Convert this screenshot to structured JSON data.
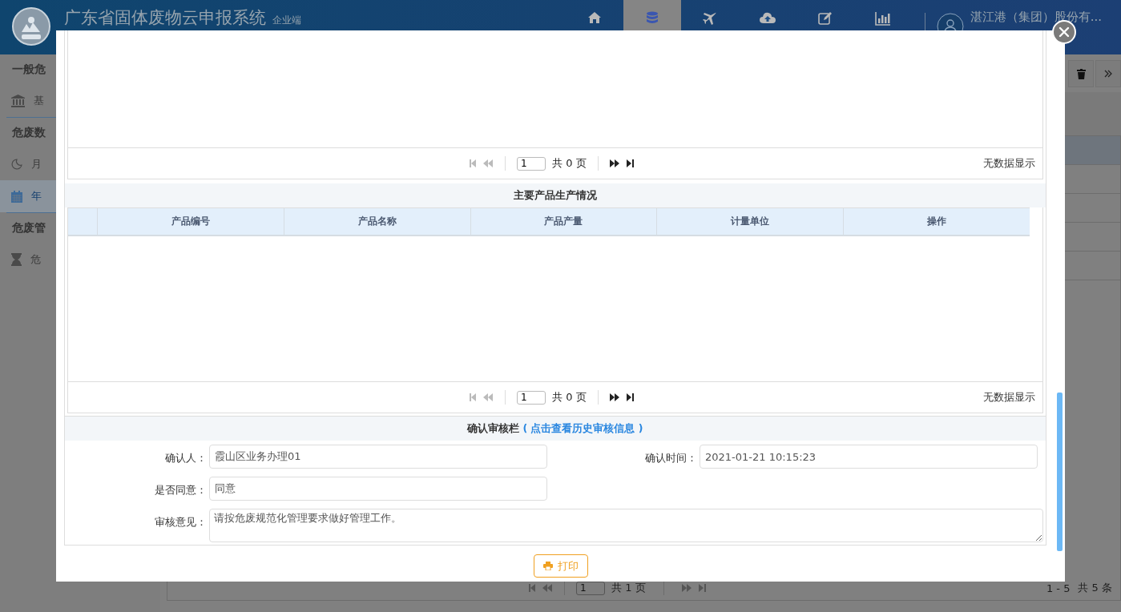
{
  "header": {
    "title": "广东省固体废物云申报系统",
    "subtitle": "企业端",
    "nav": [
      {
        "kind": "home",
        "selected": false
      },
      {
        "kind": "database",
        "selected": true
      },
      {
        "kind": "plane",
        "selected": false
      },
      {
        "kind": "upload",
        "selected": false
      },
      {
        "kind": "edit",
        "selected": false
      },
      {
        "kind": "chart",
        "selected": false
      }
    ],
    "user": "湛江港（集团）股份有..."
  },
  "sidebar": {
    "groups": [
      {
        "title": "一般危",
        "items": [
          {
            "label": "基",
            "kind": "bank",
            "selected": false
          }
        ]
      },
      {
        "title": "危废数",
        "items": [
          {
            "label": "月",
            "kind": "moon",
            "selected": false
          },
          {
            "label": "年",
            "kind": "calendar",
            "selected": true
          }
        ]
      },
      {
        "title": "危废管",
        "items": [
          {
            "label": "危",
            "kind": "hourglass",
            "selected": false
          }
        ]
      }
    ]
  },
  "background_list": {
    "pager": {
      "page": "1",
      "total": "共 1 页",
      "range": "1 - 5",
      "count": "共 5 条"
    }
  },
  "dialog": {
    "pager_1": {
      "page": "1",
      "total": "共 0 页",
      "status": "无数据显示"
    },
    "section_title": "主要产品生产情况",
    "columns": [
      "产品编号",
      "产品名称",
      "产品产量",
      "计量单位",
      "操作"
    ],
    "pager_2": {
      "page": "1",
      "total": "共 0 页",
      "status": "无数据显示"
    },
    "review": {
      "title": "确认审核栏",
      "link": "( 点击查看历史审核信息 )",
      "rows": [
        [
          {
            "kind": "input",
            "label": "确认人：",
            "value": "霞山区业务办理01"
          },
          {
            "kind": "input",
            "label": "确认时间：",
            "value": "2021-01-21 10:15:23"
          }
        ],
        [
          {
            "kind": "input",
            "label": "是否同意：",
            "value": "同意"
          }
        ],
        [
          {
            "kind": "textarea",
            "label": "审核意见：",
            "value": "请按危废规范化管理要求做好管理工作。"
          }
        ]
      ]
    },
    "print_button": "打印"
  }
}
